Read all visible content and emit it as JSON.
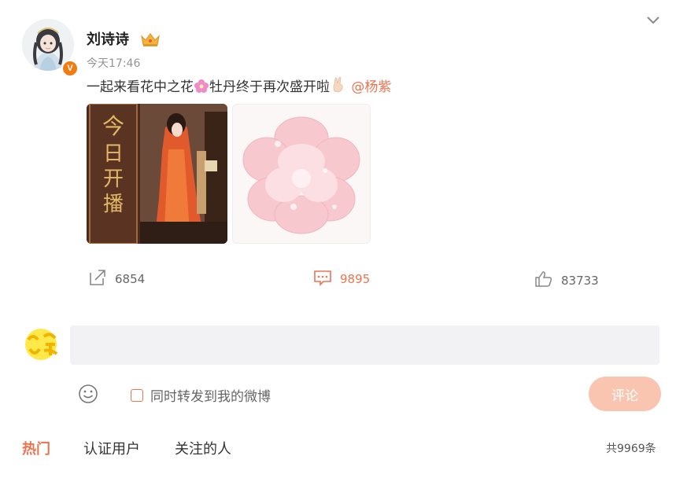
{
  "post": {
    "username": "刘诗诗",
    "time": "今天17:46",
    "text_part1": "一起来看花中之花",
    "text_part2": "牡丹终于再次盛开啦",
    "mention": "@杨紫",
    "image1_text": "今日开播"
  },
  "actions": {
    "share_count": "6854",
    "comment_count": "9895",
    "like_count": "83733"
  },
  "composer": {
    "input_value": "",
    "repost_label": "同时转发到我的微博",
    "submit_label": "评论"
  },
  "tabs": [
    "热门",
    "认证用户",
    "关注的人"
  ],
  "total_label": "共9969条",
  "colors": {
    "accent": "#eb7350",
    "submit_disabled": "#f9c5b0",
    "input_bg": "#f2f2f5",
    "badge": "#f07c14"
  },
  "icons": {
    "crown": "crown-icon",
    "verified": "verified-badge-icon",
    "share": "share-icon",
    "comment": "comment-icon",
    "like": "thumbs-up-icon",
    "smile": "emoji-icon",
    "collapse": "chevron-down-icon"
  }
}
